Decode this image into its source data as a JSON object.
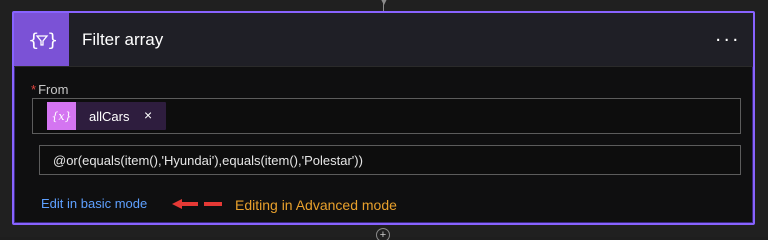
{
  "action": {
    "title": "Filter array",
    "menu_label": "...",
    "icon": "filter-array-icon",
    "header_color": "#7b52d6",
    "border_color": "#8863ff"
  },
  "from": {
    "required_marker": "*",
    "label": "From",
    "token": {
      "label": "allCars",
      "icon_glyph": "{x}",
      "remove_glyph": "×",
      "icon_color": "#d475f1"
    }
  },
  "expression": {
    "value": "@or(equals(item(),'Hyundai'),equals(item(),'Polestar'))"
  },
  "edit_mode_link": "Edit in basic mode",
  "annotation": {
    "text": "Editing in Advanced mode",
    "color": "#e8a02c"
  }
}
